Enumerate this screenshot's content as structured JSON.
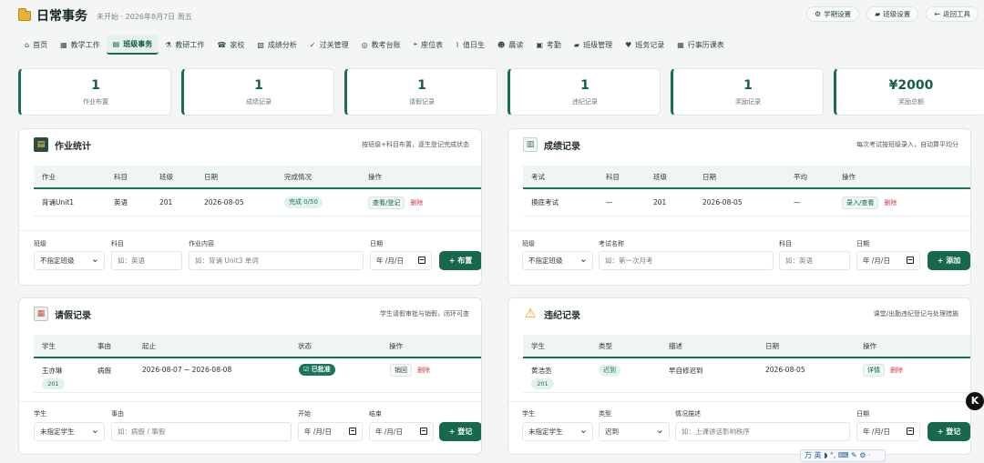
{
  "app": {
    "title": "日常事务",
    "status": "未开始",
    "date": "2026年8月7日 周五"
  },
  "header_actions": [
    {
      "icon": "gear-icon",
      "glyph": "⚙",
      "label": "学期设置"
    },
    {
      "icon": "class-building-icon",
      "glyph": "▰",
      "label": "班级设置"
    },
    {
      "icon": "back-arrow-icon",
      "glyph": "←",
      "label": "返回工具"
    }
  ],
  "tabs": [
    {
      "label": "首页",
      "icon": "home-icon",
      "glyph": "⌂"
    },
    {
      "label": "教学工作",
      "icon": "teaching-icon",
      "glyph": "▦"
    },
    {
      "label": "班级事务",
      "icon": "clipboard-icon",
      "glyph": "▤",
      "active": true
    },
    {
      "label": "教研工作",
      "icon": "microscope-icon",
      "glyph": "⚗"
    },
    {
      "label": "家校",
      "icon": "phone-icon",
      "glyph": "☎"
    },
    {
      "label": "成绩分析",
      "icon": "chart-icon",
      "glyph": "▧"
    },
    {
      "label": "过关管理",
      "icon": "check-icon",
      "glyph": "✓"
    },
    {
      "label": "教考台账",
      "icon": "target-icon",
      "glyph": "◎"
    },
    {
      "label": "座位表",
      "icon": "pin-icon",
      "glyph": "⌖"
    },
    {
      "label": "值日生",
      "icon": "broom-icon",
      "glyph": "⌇"
    },
    {
      "label": "晨读",
      "icon": "person-icon",
      "glyph": "☻"
    },
    {
      "label": "考勤",
      "icon": "attendance-icon",
      "glyph": "▣"
    },
    {
      "label": "班级管理",
      "icon": "class-icon",
      "glyph": "▰"
    },
    {
      "label": "班务记录",
      "icon": "heart-icon",
      "glyph": "♥"
    },
    {
      "label": "行事历课表",
      "icon": "calendar-icon",
      "glyph": "▦"
    }
  ],
  "stats": [
    {
      "value": "1",
      "label": "作业布置"
    },
    {
      "value": "1",
      "label": "成绩记录"
    },
    {
      "value": "1",
      "label": "请假记录"
    },
    {
      "value": "1",
      "label": "违纪记录"
    },
    {
      "value": "1",
      "label": "奖励记录"
    },
    {
      "value": "¥2000",
      "label": "奖励总额"
    }
  ],
  "homework": {
    "title": "作业统计",
    "note": "按班级+科目布置，逐生登记完成状态",
    "columns": [
      "作业",
      "科目",
      "班级",
      "日期",
      "完成情况",
      "操作"
    ],
    "row": {
      "name": "背诵Unit1",
      "subject": "英语",
      "class": "201",
      "date": "2026-08-05",
      "progress_text": "完成 0/50",
      "action": "查看/登记",
      "delete": "删除"
    },
    "form": {
      "class_label": "班级",
      "class_value": "不指定班级",
      "subject_label": "科目",
      "subject_placeholder": "如：英语",
      "content_label": "作业内容",
      "content_placeholder": "如：背诵 Unit3 单词",
      "date_label": "日期",
      "date_value": "年 /月/日",
      "button": "+ 布置"
    }
  },
  "scores": {
    "title": "成绩记录",
    "note": "每次考试按班级录入，自动算平均分",
    "columns": [
      "考试",
      "科目",
      "班级",
      "日期",
      "平均",
      "操作"
    ],
    "row": {
      "exam": "摸底考试",
      "subject": "—",
      "class": "201",
      "date": "2026-08-05",
      "average": "—",
      "action": "录入/查看",
      "delete": "删除"
    },
    "form": {
      "class_label": "班级",
      "class_value": "不指定班级",
      "exam_label": "考试名称",
      "exam_placeholder": "如：第一次月考",
      "subject_label": "科目",
      "subject_placeholder": "如：英语",
      "date_label": "日期",
      "date_value": "年 /月/日",
      "button": "+ 添加"
    }
  },
  "leave": {
    "title": "请假记录",
    "note": "学生请假审批与销假，闭环可查",
    "columns": [
      "学生",
      "事由",
      "起止",
      "状态",
      "操作"
    ],
    "row": {
      "student": "王亦琳",
      "class": "201",
      "reason": "病假",
      "period": "2026-08-07 ~ 2026-08-08",
      "status": "☑ 已批准",
      "action": "销回",
      "delete": "删除"
    },
    "form": {
      "student_label": "学生",
      "student_value": "未指定学生",
      "reason_label": "事由",
      "reason_placeholder": "如：病假 / 事假",
      "start_label": "开始",
      "end_label": "结束",
      "date_value": "年 /月/日",
      "button": "+ 登记"
    }
  },
  "discipline": {
    "title": "违纪记录",
    "note": "课堂/出勤违纪登记与处理措施",
    "columns": [
      "学生",
      "类型",
      "描述",
      "日期",
      "操作"
    ],
    "row": {
      "student": "黄浩丞",
      "class": "201",
      "type": "迟到",
      "description": "早自修迟到",
      "date": "2026-08-05",
      "action": "详情",
      "delete": "删除"
    },
    "form": {
      "student_label": "学生",
      "student_value": "未指定学生",
      "type_label": "类型",
      "type_value": "迟到",
      "description_label": "情况描述",
      "description_placeholder": "如：上课讲话影响秩序",
      "date_label": "日期",
      "date_value": "年 /月/日",
      "button": "+ 登记"
    }
  },
  "ime_text": "万 英 ◗ °, ⌨ ✎ ⚙ ·",
  "floating_letter": "K"
}
